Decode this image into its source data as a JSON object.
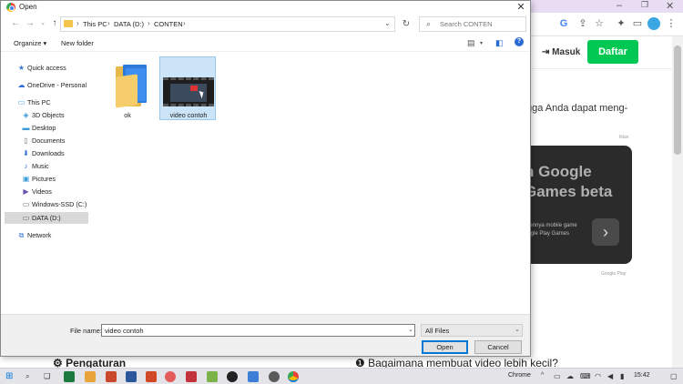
{
  "background": {
    "chrome_buttons": {
      "minimize": "–",
      "restore": "❐",
      "close": "✕"
    },
    "header": {
      "login_label": "Masuk",
      "register_label": "Daftar"
    },
    "article_text": "gga Anda dapat meng-",
    "ad_label": "Iklan",
    "promo": {
      "title": "n Google\nGames beta",
      "subtitle": "erennya mobile game\noogle Play Games",
      "arrow": "›",
      "caption": "Google Play"
    },
    "bottom_left": "Pengaturan",
    "bottom_right": "Bagaimana membuat video lebih kecil?"
  },
  "dialog": {
    "title": "Open",
    "close_glyph": "✕",
    "breadcrumb": [
      "This PC",
      "DATA (D:)",
      "CONTEN"
    ],
    "search_placeholder": "Search CONTEN",
    "organize_label": "Organize ▾",
    "new_folder_label": "New folder",
    "help_glyph": "?",
    "nav_items": [
      {
        "label": "Quick access",
        "icon": "star-icon"
      },
      {
        "label": "OneDrive - Personal",
        "icon": "cloud-icon"
      },
      {
        "label": "This PC",
        "icon": "pc-icon"
      },
      {
        "label": "3D Objects",
        "icon": "cube-icon"
      },
      {
        "label": "Desktop",
        "icon": "desktop-icon"
      },
      {
        "label": "Documents",
        "icon": "document-icon"
      },
      {
        "label": "Downloads",
        "icon": "download-icon"
      },
      {
        "label": "Music",
        "icon": "music-icon"
      },
      {
        "label": "Pictures",
        "icon": "picture-icon"
      },
      {
        "label": "Videos",
        "icon": "video-icon"
      },
      {
        "label": "Windows-SSD (C:)",
        "icon": "drive-icon"
      },
      {
        "label": "DATA (D:)",
        "icon": "drive-icon"
      },
      {
        "label": "Network",
        "icon": "network-icon"
      }
    ],
    "files": [
      {
        "name": "ok",
        "type": "folder"
      },
      {
        "name": "video contoh",
        "type": "video"
      }
    ],
    "file_name_label": "File name:",
    "file_name_value": "video contoh",
    "file_type_value": "All Files",
    "open_label": "Open",
    "cancel_label": "Cancel"
  },
  "taskbar": {
    "chrome_label": "Chrome",
    "time": "15:42",
    "colors": {
      "accent": "#0078d7",
      "register_green": "#00c853"
    }
  }
}
